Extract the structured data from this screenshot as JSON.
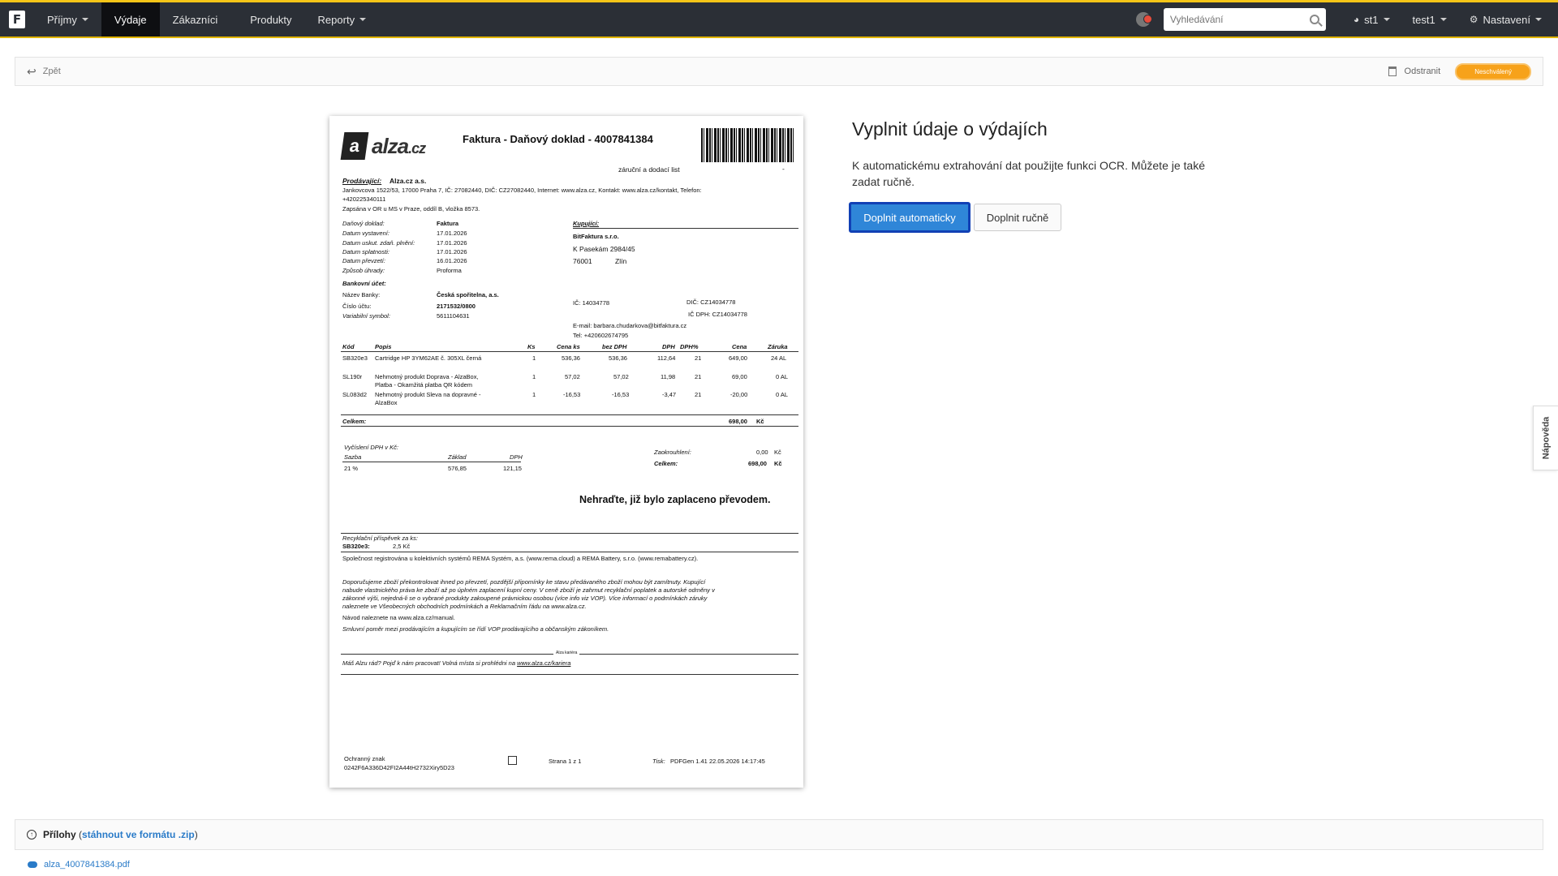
{
  "nav": {
    "items": [
      {
        "label": "Příjmy",
        "dropdown": true,
        "active": false
      },
      {
        "label": "Výdaje",
        "dropdown": false,
        "active": true
      },
      {
        "label": "Zákazníci",
        "dropdown": false,
        "active": false
      },
      {
        "label": "Produkty",
        "dropdown": false,
        "active": false
      },
      {
        "label": "Reporty",
        "dropdown": true,
        "active": false
      }
    ],
    "search_placeholder": "Vyhledávání",
    "user1": "st1",
    "user2": "test1",
    "settings": "Nastavení",
    "accent": "#f5c518"
  },
  "toolbar": {
    "back": "Zpět",
    "delete": "Odstranit",
    "status": "Neschválený",
    "status_color": "#f7a21a"
  },
  "invoice": {
    "title": "Faktura - Daňový doklad - 4007841384",
    "subtitle": "záruční a dodací list",
    "seller_label": "Prodávající:",
    "seller_name": "Alza.cz a.s.",
    "seller_addr1": "Jankovcova 1522/53, 17000 Praha 7, IČ: 27082440, DIČ: CZ27082440, Internet: www.alza.cz, Kontakt: www.alza.cz/kontakt, Telefon:",
    "seller_addr2": "+420225340111",
    "seller_addr3": "Zapsána v OR u MS v Praze, oddíl B, vložka 8573.",
    "doc_rows": [
      {
        "k": "Daňový doklad:",
        "v": "Faktura",
        "bold": true
      },
      {
        "k": "Datum vystavení:",
        "v": "17.01.2026",
        "bold": false
      },
      {
        "k": "Datum uskut. zdaň. plnění:",
        "v": "17.01.2026",
        "bold": false
      },
      {
        "k": "Datum splatnosti:",
        "v": "17.01.2026",
        "bold": false
      },
      {
        "k": "Datum převzetí:",
        "v": "16.01.2026",
        "bold": false
      },
      {
        "k": "Způsob úhrady:",
        "v": "Proforma",
        "bold": false
      }
    ],
    "bank_label": "Bankovní účet:",
    "bank_rows": [
      {
        "k": "Název Banky:",
        "v": "Česká spořitelna, a.s."
      },
      {
        "k": "Číslo účtu:",
        "v": "2171532/0800"
      },
      {
        "k": "Variabilní symbol:",
        "v": "5611104631"
      }
    ],
    "buyer_label": "Kupující:",
    "buyer_name": "BitFaktura s.r.o.",
    "buyer_street": "K Pasekám 2984/45",
    "buyer_zip": "76001",
    "buyer_city": "Zlín",
    "buyer_ic": "IČ: 14034778",
    "buyer_dic": "DIČ: CZ14034778",
    "buyer_icdph": "IČ DPH: CZ14034778",
    "buyer_email": "E-mail: barbara.chudarkova@bitfaktura.cz",
    "buyer_tel": "Tel: +420602674795",
    "table_head": [
      "Kód",
      "Popis",
      "Ks",
      "Cena ks",
      "bez DPH",
      "DPH",
      "DPH%",
      "Cena",
      "Záruka"
    ],
    "table_rows": [
      {
        "code": "SB320e3",
        "desc1": "Cartridge HP 3YM62AE č. 305XL černá",
        "desc2": "",
        "ks": "1",
        "cena_ks": "536,36",
        "bez": "536,36",
        "dph": "112,64",
        "pct": "21",
        "cena": "649,00",
        "zaruka": "24 AL"
      },
      {
        "code": "SL190r",
        "desc1": "Nehmotný produkt Doprava - AlzaBox,",
        "desc2": "Platba - Okamžitá platba QR kódem",
        "ks": "1",
        "cena_ks": "57,02",
        "bez": "57,02",
        "dph": "11,98",
        "pct": "21",
        "cena": "69,00",
        "zaruka": "0 AL"
      },
      {
        "code": "SL083d2",
        "desc1": "Nehmotný produkt Sleva na dopravné -",
        "desc2": "AlzaBox",
        "ks": "1",
        "cena_ks": "-16,53",
        "bez": "-16,53",
        "dph": "-3,47",
        "pct": "21",
        "cena": "-20,00",
        "zaruka": "0 AL"
      }
    ],
    "total_label": "Celkem:",
    "total_value": "698,00",
    "currency": "Kč",
    "vat_title": "Vyčíslení DPH v Kč:",
    "vat_head": [
      "Sazba",
      "Základ",
      "DPH"
    ],
    "vat_row": [
      "21 %",
      "576,85",
      "121,15"
    ],
    "round_label": "Zaokrouhlení:",
    "round_value": "0,00",
    "sum_label": "Celkem:",
    "sum_value": "698,00",
    "paid_note": "Nehraďte, již bylo zaplaceno převodem.",
    "recycle_label": "Recyklační příspěvek za ks:",
    "recycle_code": "SB320e3:",
    "recycle_value": "2,5 Kč",
    "rema": "Společnost registrována u kolektivních systémů REMA Systém, a.s. (www.rema.cloud) a REMA Battery, s.r.o. (www.remabattery.cz).",
    "terms": [
      "Doporučujeme zboží překontrolovat ihned po převzetí, pozdější připomínky ke stavu předávaného zboží mohou být zamítnuty. Kupující",
      "nabude vlastnického práva ke zboží až po úplném zaplacení kupní ceny. V ceně zboží je zahrnut recyklační poplatek a autorské odměny v",
      "zákonné výši, nejedná-li se o vybrané produkty zakoupené právnickou osobou (více info viz VOP). Více informací o podmínkách záruky",
      "naleznete ve Všeobecných obchodních podmínkách a Reklamačním řádu na www.alza.cz."
    ],
    "manual": "Návod naleznete na www.alza.cz/manual.",
    "contract": "Smluvní poměr mezi prodávajícím a kupujícím se řídí VOP prodávajícího a občanským zákoníkem.",
    "career_small": "Alza kariéra",
    "career_text": "Máš Alzu rád? Pojď k nám pracovat! Volná místa si prohlédni na",
    "career_link": "www.alza.cz/kariera",
    "guard_label": "Ochranný znak",
    "guard_code": "0242F6A336D42FI2A44tH2732Xiry5D23",
    "page": "Strana 1 z 1",
    "print_label": "Tisk:",
    "print_value": "PDFGen 1.41   22.05.2026 14:17:45"
  },
  "panel": {
    "title": "Vyplnit údaje o výdajích",
    "desc": "K automatickému extrahování dat použijte funkci OCR. Můžete je také zadat ručně.",
    "btn_auto": "Doplnit automaticky",
    "btn_manual": "Doplnit ručně",
    "btn_auto_color": "#2f86d8"
  },
  "help": {
    "label": "Nápověda"
  },
  "attachments": {
    "title": "Přílohy",
    "link": "stáhnout ve formátu .zip",
    "file": "alza_4007841384.pdf"
  }
}
